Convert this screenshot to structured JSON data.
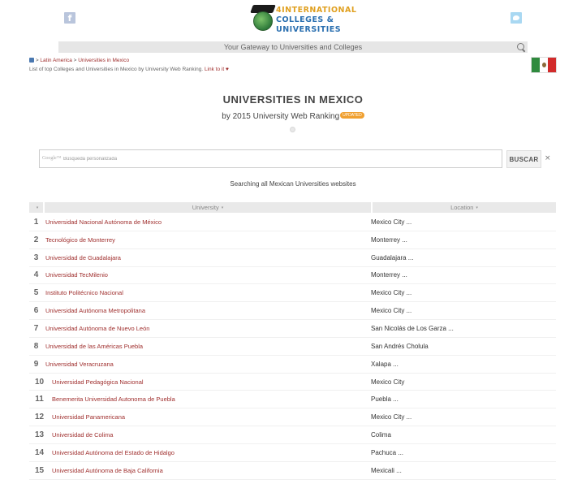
{
  "header": {
    "facebook_glyph": "f",
    "logo": {
      "line1": "4INTERNATIONAL",
      "line2": "COLLEGES &",
      "line3": "UNIVERSITIES"
    },
    "gateway_text": "Your Gateway to Universities and Colleges"
  },
  "breadcrumb": {
    "home_icon": "home-icon",
    "sep1": ">",
    "region": "Latin America",
    "sep2": ">",
    "current": "Universities in Mexico"
  },
  "subline": {
    "text": "List of top Colleges and Universities in Mexico by University Web Ranking.",
    "link": "Link to it ♥"
  },
  "page": {
    "title": "UNIVERSITIES IN MEXICO",
    "subtitle": "by 2015 University Web Ranking",
    "badge": "UPDATED"
  },
  "search": {
    "google_label": "Google™",
    "placeholder": "Búsqueda personalizada",
    "button": "BUSCAR",
    "clear": "×",
    "caption": "Searching all Mexican Universities websites"
  },
  "table": {
    "columns": [
      "University",
      "Location"
    ],
    "sort_icon": "▾",
    "rows": [
      {
        "rank": "1",
        "name": "Universidad Nacional Autónoma de México",
        "location": "Mexico City ..."
      },
      {
        "rank": "2",
        "name": "Tecnológico de Monterrey",
        "location": "Monterrey ..."
      },
      {
        "rank": "3",
        "name": "Universidad de Guadalajara",
        "location": "Guadalajara ..."
      },
      {
        "rank": "4",
        "name": "Universidad TecMilenio",
        "location": "Monterrey ..."
      },
      {
        "rank": "5",
        "name": "Instituto Politécnico Nacional",
        "location": "Mexico City ..."
      },
      {
        "rank": "6",
        "name": "Universidad Autónoma Metropolitana",
        "location": "Mexico City ..."
      },
      {
        "rank": "7",
        "name": "Universidad Autónoma de Nuevo León",
        "location": "San Nicolás de Los Garza ..."
      },
      {
        "rank": "8",
        "name": "Universidad de las Américas Puebla",
        "location": "San Andrés Cholula"
      },
      {
        "rank": "9",
        "name": "Universidad Veracruzana",
        "location": "Xalapa ..."
      },
      {
        "rank": "10",
        "name": "Universidad Pedagógica Nacional",
        "location": "Mexico City"
      },
      {
        "rank": "11",
        "name": "Benemerita Universidad Autonoma de Puebla",
        "location": "Puebla ..."
      },
      {
        "rank": "12",
        "name": "Universidad Panamericana",
        "location": "Mexico City ..."
      },
      {
        "rank": "13",
        "name": "Universidad de Colima",
        "location": "Colima"
      },
      {
        "rank": "14",
        "name": "Universidad Autónoma del Estado de Hidalgo",
        "location": "Pachuca ..."
      },
      {
        "rank": "15",
        "name": "Universidad Autónoma de Baja California",
        "location": "Mexicali ..."
      }
    ]
  }
}
